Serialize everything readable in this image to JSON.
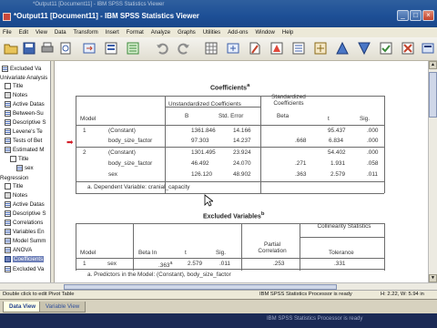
{
  "window": {
    "ghost_title": "*Output11 [Document11] - IBM SPSS Statistics Viewer",
    "title": "*Output11 [Document11] - IBM SPSS Statistics Viewer",
    "buttons": {
      "minimize": "_",
      "maximize": "□",
      "close": "×"
    }
  },
  "menu": [
    "File",
    "Edit",
    "View",
    "Data",
    "Transform",
    "Insert",
    "Format",
    "Analyze",
    "Graphs",
    "Utilities",
    "Add-ons",
    "Window",
    "Help"
  ],
  "toolbar": [
    "open-icon",
    "save-icon",
    "print-icon",
    "print-preview-icon",
    "export-icon",
    "recall-dialog-icon",
    "undo-icon",
    "redo-icon",
    "goto-data-icon",
    "goto-case-icon",
    "variables-icon",
    "designate-window-icon",
    "select-output-icon",
    "promote-icon",
    "demote-icon",
    "expand-icon",
    "collapse-icon",
    "show-icon",
    "hide-icon",
    "insert-heading-icon"
  ],
  "outline": {
    "items": [
      "Excluded Va",
      "Univariate Analysis",
      "Title",
      "Notes",
      "Active Datas",
      "Between-Su",
      "Descriptive S",
      "Levene's Te",
      "Tests of Bet",
      "Estimated M",
      "Title",
      "sex",
      "Regression",
      "Title",
      "Notes",
      "Active Datas",
      "Descriptive S",
      "Correlations",
      "Variables En",
      "Model Summ",
      "ANOVA",
      "Coefficients",
      "Excluded Va"
    ]
  },
  "coefficients": {
    "title": "Coefficients",
    "title_sup": "a",
    "headers": {
      "model": "Model",
      "unstd": "Unstandardized Coefficients",
      "std": "Standardized Coefficients",
      "b": "B",
      "se": "Std. Error",
      "beta": "Beta",
      "t": "t",
      "sig": "Sig."
    },
    "rows": [
      {
        "model": "1",
        "term": "(Constant)",
        "b": "1361.846",
        "se": "14.166",
        "beta": "",
        "t": "95.437",
        "sig": ".000"
      },
      {
        "model": "",
        "term": "body_size_factor",
        "b": "97.303",
        "se": "14.237",
        "beta": ".668",
        "t": "6.834",
        "sig": ".000"
      },
      {
        "model": "2",
        "term": "(Constant)",
        "b": "1301.495",
        "se": "23.924",
        "beta": "",
        "t": "54.402",
        "sig": ".000"
      },
      {
        "model": "",
        "term": "body_size_factor",
        "b": "46.492",
        "se": "24.070",
        "beta": ".271",
        "t": "1.931",
        "sig": ".058"
      },
      {
        "model": "",
        "term": "sex",
        "b": "126.120",
        "se": "48.902",
        "beta": ".363",
        "t": "2.579",
        "sig": ".011"
      }
    ],
    "footnote": "a. Dependent Variable: cranial_capacity"
  },
  "excluded": {
    "title": "Excluded Variables",
    "title_sup": "b",
    "headers": {
      "model": "Model",
      "beta_in": "Beta In",
      "t": "t",
      "sig": "Sig.",
      "partial": "Partial Correlation",
      "collin": "Collinearity Statistics",
      "tolerance": "Tolerance"
    },
    "rows": [
      {
        "model": "1",
        "term": "sex",
        "beta_in": ".363",
        "beta_sup": "a",
        "t": "2.579",
        "sig": ".011",
        "partial": ".253",
        "tolerance": ".331"
      }
    ],
    "footnote": "a. Predictors in the Model: (Constant), body_size_factor"
  },
  "status": {
    "hint": "Double click to edit Pivot Table",
    "processor": "IBM SPSS Statistics Processor is ready",
    "coords": "H: 2.22, W: 5.94 in"
  },
  "tabs": {
    "data_view": "Data View",
    "variable_view": "Variable View"
  },
  "taskbar": {
    "status": "IBM SPSS Statistics Processor is ready"
  },
  "colors": {
    "title_bar": "#1d4f96",
    "active_tab": "#ffffe5",
    "arrow_marker": "#d3202a"
  }
}
